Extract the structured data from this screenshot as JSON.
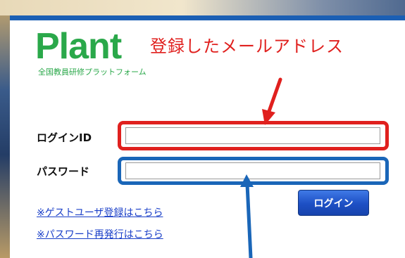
{
  "logo": {
    "title": "Plant",
    "subtitle": "全国教員研修プラットフォーム"
  },
  "annotation": {
    "email_note": "登録したメールアドレス"
  },
  "form": {
    "login_id_label": "ログインID",
    "login_id_value": "",
    "password_label": "パスワード",
    "password_value": ""
  },
  "links": {
    "guest_register": "※ゲストユーザ登録はこちら",
    "password_reissue": "※パスワード再発行はこちら"
  },
  "buttons": {
    "login": "ログイン"
  },
  "colors": {
    "brand_green": "#2aa84a",
    "header_blue": "#1b5fb4",
    "annotation_red": "#e0201e",
    "annotation_blue": "#1a66b8",
    "button_blue": "#1d4fc4",
    "link_blue": "#1a3fc8"
  }
}
